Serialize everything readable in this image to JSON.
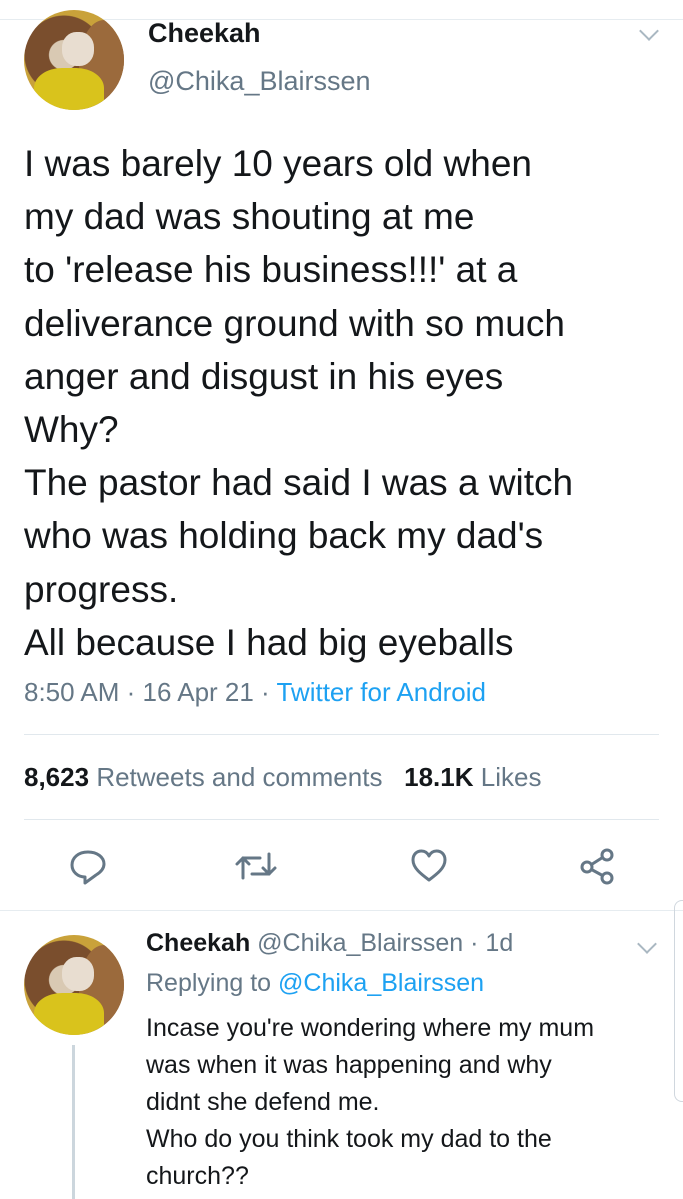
{
  "tweet": {
    "display_name": "Cheekah",
    "handle": "@Chika_Blairssen",
    "lines": [
      "I was barely 10 years old when",
      "my dad was shouting at me",
      "to 'release his business!!!' at a",
      "deliverance ground with so much",
      "anger and disgust in his eyes",
      "Why?",
      "The pastor had said I was a witch",
      "who was holding back my dad's",
      "progress.",
      "All because I had big eyeballs"
    ],
    "time": "8:50 AM",
    "dot1": " · ",
    "date": "16 Apr 21",
    "dot2": " · ",
    "source": "Twitter for Android"
  },
  "stats": {
    "retweets_count": "8,623",
    "retweets_label": "Retweets and comments",
    "likes_count": "18.1K",
    "likes_label": "Likes"
  },
  "actions": {
    "icons": [
      "reply-icon",
      "retweet-icon",
      "like-icon",
      "share-icon"
    ],
    "color": "#657786"
  },
  "reply": {
    "display_name": "Cheekah",
    "handle": "@Chika_Blairssen",
    "age": " · 1d",
    "replying_prefix": "Replying to ",
    "replying_to": "@Chika_Blairssen",
    "lines": [
      "Incase you're wondering where my mum",
      "was when it was happening and why",
      "didnt she defend me.",
      "Who do you think took my dad to the",
      "church??"
    ]
  },
  "colors": {
    "accent": "#1da1f2",
    "secondary_text": "#657786",
    "primary_text": "#14171a"
  }
}
